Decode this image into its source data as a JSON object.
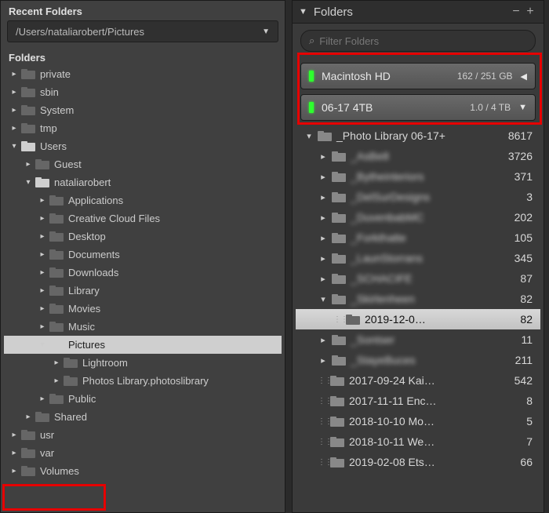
{
  "left": {
    "recent_label": "Recent Folders",
    "recent_path": "/Users/nataliarobert/Pictures",
    "folders_label": "Folders",
    "tree": [
      {
        "d": 0,
        "disc": "right",
        "name": "private"
      },
      {
        "d": 0,
        "disc": "right",
        "name": "sbin"
      },
      {
        "d": 0,
        "disc": "right",
        "name": "System"
      },
      {
        "d": 0,
        "disc": "right",
        "name": "tmp"
      },
      {
        "d": 0,
        "disc": "down",
        "name": "Users",
        "light": true
      },
      {
        "d": 1,
        "disc": "right",
        "name": "Guest"
      },
      {
        "d": 1,
        "disc": "down",
        "name": "nataliarobert",
        "light": true
      },
      {
        "d": 2,
        "disc": "right",
        "name": "Applications"
      },
      {
        "d": 2,
        "disc": "right",
        "name": "Creative Cloud Files"
      },
      {
        "d": 2,
        "disc": "right",
        "name": "Desktop"
      },
      {
        "d": 2,
        "disc": "right",
        "name": "Documents"
      },
      {
        "d": 2,
        "disc": "right",
        "name": "Downloads"
      },
      {
        "d": 2,
        "disc": "right",
        "name": "Library"
      },
      {
        "d": 2,
        "disc": "right",
        "name": "Movies"
      },
      {
        "d": 2,
        "disc": "right",
        "name": "Music"
      },
      {
        "d": 2,
        "disc": "down",
        "name": "Pictures",
        "sel": true,
        "light": true
      },
      {
        "d": 3,
        "disc": "right",
        "name": "Lightroom"
      },
      {
        "d": 3,
        "disc": "right",
        "name": "Photos Library.photoslibrary"
      },
      {
        "d": 2,
        "disc": "right",
        "name": "Public"
      },
      {
        "d": 1,
        "disc": "right",
        "name": "Shared"
      },
      {
        "d": 0,
        "disc": "right",
        "name": "usr"
      },
      {
        "d": 0,
        "disc": "right",
        "name": "var"
      },
      {
        "d": 0,
        "disc": "right",
        "name": "Volumes"
      }
    ]
  },
  "right": {
    "header": "Folders",
    "filter_placeholder": "Filter Folders",
    "volumes": [
      {
        "name": "Macintosh HD",
        "cap": "162 / 251 GB",
        "arrow": "◀"
      },
      {
        "name": "06-17 4TB",
        "cap": "1.0 / 4 TB",
        "arrow": "▼"
      }
    ],
    "rows": [
      {
        "d": 0,
        "disc": "down",
        "name": "_Photo Library 06-17+",
        "count": 8617
      },
      {
        "d": 1,
        "disc": "right",
        "name": "_AsBe8",
        "count": 3726,
        "blur": true
      },
      {
        "d": 1,
        "disc": "right",
        "name": "_Bytheinteriors",
        "count": 371,
        "blur": true
      },
      {
        "d": 1,
        "disc": "right",
        "name": "_DelSurDesigns",
        "count": 3,
        "blur": true
      },
      {
        "d": 1,
        "disc": "right",
        "name": "_DuvenbabMC",
        "count": 202,
        "blur": true
      },
      {
        "d": 1,
        "disc": "right",
        "name": "_Forkthatte",
        "count": 105,
        "blur": true
      },
      {
        "d": 1,
        "disc": "right",
        "name": "_LaunStorrans",
        "count": 345,
        "blur": true
      },
      {
        "d": 1,
        "disc": "right",
        "name": "_SCHACIFE",
        "count": 87,
        "blur": true
      },
      {
        "d": 1,
        "disc": "down",
        "name": "_Skirlenheen",
        "count": 82,
        "blur": true
      },
      {
        "d": 2,
        "disc": "dots",
        "name": "2019-12-0…",
        "count": 82,
        "sel": true
      },
      {
        "d": 1,
        "disc": "right",
        "name": "_Sontser",
        "count": 11,
        "blur": true
      },
      {
        "d": 1,
        "disc": "right",
        "name": "_StayeBuces",
        "count": 211,
        "blur": true
      },
      {
        "d": 1,
        "disc": "dots",
        "name": "2017-09-24 Kai…",
        "count": 542
      },
      {
        "d": 1,
        "disc": "dots",
        "name": "2017-11-11 Enc…",
        "count": 8
      },
      {
        "d": 1,
        "disc": "dots",
        "name": "2018-10-10 Mo…",
        "count": 5
      },
      {
        "d": 1,
        "disc": "dots",
        "name": "2018-10-11 We…",
        "count": 7
      },
      {
        "d": 1,
        "disc": "dots",
        "name": "2019-02-08 Ets…",
        "count": 66
      }
    ]
  }
}
